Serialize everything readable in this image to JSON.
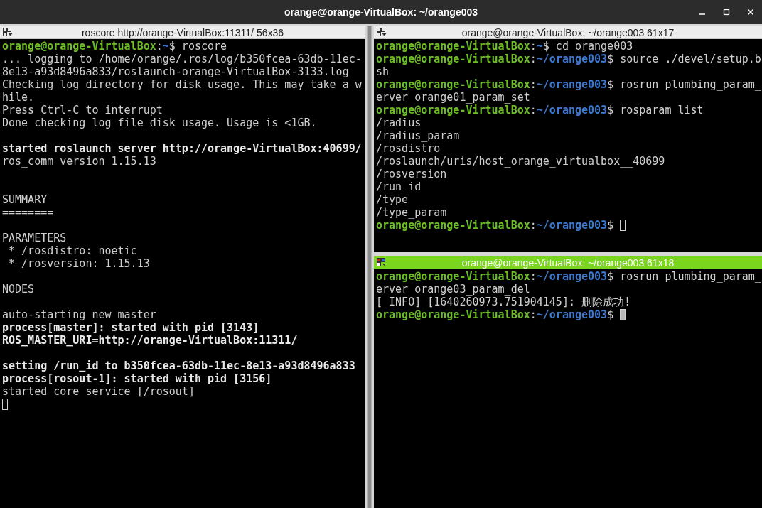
{
  "window": {
    "title": "orange@orange-VirtualBox: ~/orange003"
  },
  "panes": [
    {
      "title": "roscore http://orange-VirtualBox:11311/ 56x36",
      "focused": false,
      "lines": [
        {
          "kind": "prompt",
          "user": "orange@orange-VirtualBox",
          "separator": ":",
          "path": "~",
          "sign": "$",
          "command": "roscore"
        },
        {
          "kind": "output",
          "text": "... logging to /home/orange/.ros/log/b350fcea-63db-11ec-",
          "bold": false
        },
        {
          "kind": "output",
          "text": "8e13-a93d8496a833/roslaunch-orange-VirtualBox-3133.log",
          "bold": false
        },
        {
          "kind": "output",
          "text": "Checking log directory for disk usage. This may take a w",
          "bold": false
        },
        {
          "kind": "output",
          "text": "hile.",
          "bold": false
        },
        {
          "kind": "output",
          "text": "Press Ctrl-C to interrupt",
          "bold": false
        },
        {
          "kind": "output",
          "text": "Done checking log file disk usage. Usage is <1GB.",
          "bold": false
        },
        {
          "kind": "blank"
        },
        {
          "kind": "output",
          "text": "started roslaunch server http://orange-VirtualBox:40699/",
          "bold": true
        },
        {
          "kind": "output",
          "text": "ros_comm version 1.15.13",
          "bold": false
        },
        {
          "kind": "blank"
        },
        {
          "kind": "blank"
        },
        {
          "kind": "output",
          "text": "SUMMARY",
          "bold": false
        },
        {
          "kind": "output",
          "text": "========",
          "bold": false
        },
        {
          "kind": "blank"
        },
        {
          "kind": "output",
          "text": "PARAMETERS",
          "bold": false
        },
        {
          "kind": "output",
          "text": " * /rosdistro: noetic",
          "bold": false
        },
        {
          "kind": "output",
          "text": " * /rosversion: 1.15.13",
          "bold": false
        },
        {
          "kind": "blank"
        },
        {
          "kind": "output",
          "text": "NODES",
          "bold": false
        },
        {
          "kind": "blank"
        },
        {
          "kind": "output",
          "text": "auto-starting new master",
          "bold": false
        },
        {
          "kind": "output",
          "text": "process[master]: started with pid [3143]",
          "bold": true
        },
        {
          "kind": "output",
          "text": "ROS_MASTER_URI=http://orange-VirtualBox:11311/",
          "bold": true
        },
        {
          "kind": "blank"
        },
        {
          "kind": "output",
          "text": "setting /run_id to b350fcea-63db-11ec-8e13-a93d8496a833",
          "bold": true
        },
        {
          "kind": "output",
          "text": "process[rosout-1]: started with pid [3156]",
          "bold": true
        },
        {
          "kind": "output",
          "text": "started core service [/rosout]",
          "bold": false
        },
        {
          "kind": "cursor",
          "cursor_filled": false
        }
      ]
    },
    {
      "title": "orange@orange-VirtualBox: ~/orange003 61x17",
      "focused": false,
      "lines": [
        {
          "kind": "prompt",
          "user": "orange@orange-VirtualBox",
          "separator": ":",
          "path": "~",
          "sign": "$",
          "command": "cd orange003"
        },
        {
          "kind": "prompt",
          "user": "orange@orange-VirtualBox",
          "separator": ":",
          "path": "~/orange003",
          "sign": "$",
          "command": "source ./devel/setup.b"
        },
        {
          "kind": "output",
          "text": "sh",
          "bold": false
        },
        {
          "kind": "prompt",
          "user": "orange@orange-VirtualBox",
          "separator": ":",
          "path": "~/orange003",
          "sign": "$",
          "command": "rosrun plumbing_param_"
        },
        {
          "kind": "output",
          "text": "erver orange01_param_set",
          "bold": false
        },
        {
          "kind": "prompt",
          "user": "orange@orange-VirtualBox",
          "separator": ":",
          "path": "~/orange003",
          "sign": "$",
          "command": "rosparam list"
        },
        {
          "kind": "output",
          "text": "/radius",
          "bold": false
        },
        {
          "kind": "output",
          "text": "/radius_param",
          "bold": false
        },
        {
          "kind": "output",
          "text": "/rosdistro",
          "bold": false
        },
        {
          "kind": "output",
          "text": "/roslaunch/uris/host_orange_virtualbox__40699",
          "bold": false
        },
        {
          "kind": "output",
          "text": "/rosversion",
          "bold": false
        },
        {
          "kind": "output",
          "text": "/run_id",
          "bold": false
        },
        {
          "kind": "output",
          "text": "/type",
          "bold": false
        },
        {
          "kind": "output",
          "text": "/type_param",
          "bold": false
        },
        {
          "kind": "prompt",
          "user": "orange@orange-VirtualBox",
          "separator": ":",
          "path": "~/orange003",
          "sign": "$",
          "cursor": true,
          "cursor_filled": false
        }
      ]
    },
    {
      "title": "orange@orange-VirtualBox: ~/orange003 61x18",
      "focused": true,
      "lines": [
        {
          "kind": "prompt",
          "user": "orange@orange-VirtualBox",
          "separator": ":",
          "path": "~/orange003",
          "sign": "$",
          "command": "rosrun plumbing_param_"
        },
        {
          "kind": "output",
          "text": "erver orange03_param_del",
          "bold": false
        },
        {
          "kind": "output",
          "text": "[ INFO] [1640260973.751904145]: 删除成功!",
          "bold": false
        },
        {
          "kind": "prompt",
          "user": "orange@orange-VirtualBox",
          "separator": ":",
          "path": "~/orange003",
          "sign": "$",
          "cursor": true,
          "cursor_filled": true
        }
      ]
    }
  ]
}
